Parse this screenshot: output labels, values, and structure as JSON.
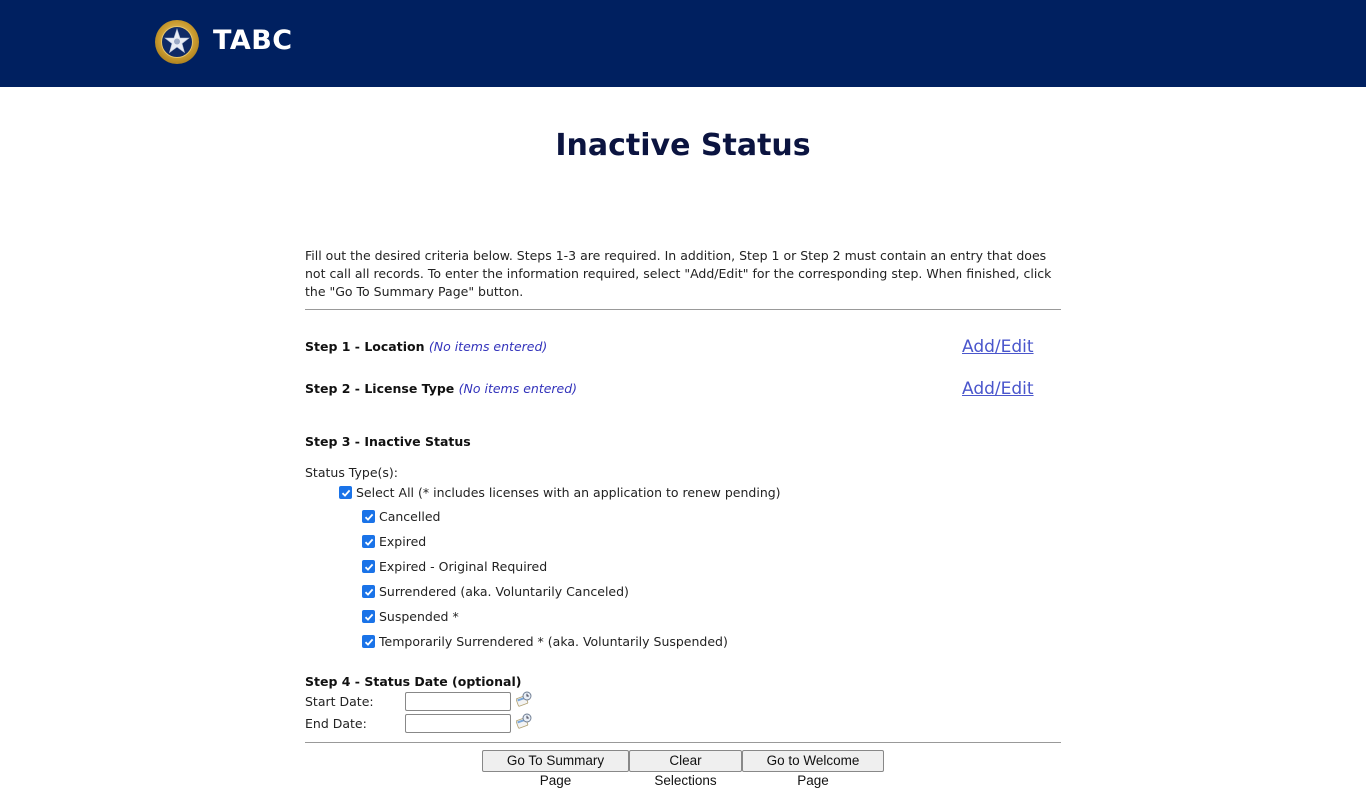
{
  "header": {
    "brand": "TABC",
    "logo_icon": "tabc-seal-icon",
    "colors": {
      "background": "#002060",
      "title": "#0b1440",
      "link": "#4a56cc",
      "note": "#3333bb"
    }
  },
  "page": {
    "title": "Inactive Status",
    "intro": "Fill out the desired criteria below. Steps 1-3 are required. In addition, Step 1 or Step 2 must contain an entry that does not call all records. To enter the information required, select \"Add/Edit\" for the corresponding step. When finished, click the \"Go To Summary Page\" button."
  },
  "steps": {
    "step1": {
      "label": "Step 1 - Location",
      "note": "(No items entered)",
      "action": "Add/Edit"
    },
    "step2": {
      "label": "Step 2 - License Type",
      "note": "(No items entered)",
      "action": "Add/Edit"
    },
    "step3": {
      "label": "Step 3 - Inactive Status",
      "status_types_label": "Status Type(s):",
      "select_all": {
        "label": "Select All (* includes licenses with an application to renew pending)",
        "checked": true
      },
      "options": [
        {
          "label": "Cancelled",
          "checked": true
        },
        {
          "label": "Expired",
          "checked": true
        },
        {
          "label": "Expired - Original Required",
          "checked": true
        },
        {
          "label": "Surrendered (aka. Voluntarily Canceled)",
          "checked": true
        },
        {
          "label": "Suspended *",
          "checked": true
        },
        {
          "label": "Temporarily Surrendered * (aka. Voluntarily Suspended)",
          "checked": true
        }
      ]
    },
    "step4": {
      "label": "Step 4 - Status Date (optional)",
      "start_label": "Start Date:",
      "start_value": "",
      "end_label": "End Date:",
      "end_value": "",
      "calendar_icon": "calendar-icon"
    }
  },
  "buttons": {
    "summary": "Go To Summary Page",
    "clear": "Clear Selections",
    "welcome": "Go to Welcome Page"
  }
}
